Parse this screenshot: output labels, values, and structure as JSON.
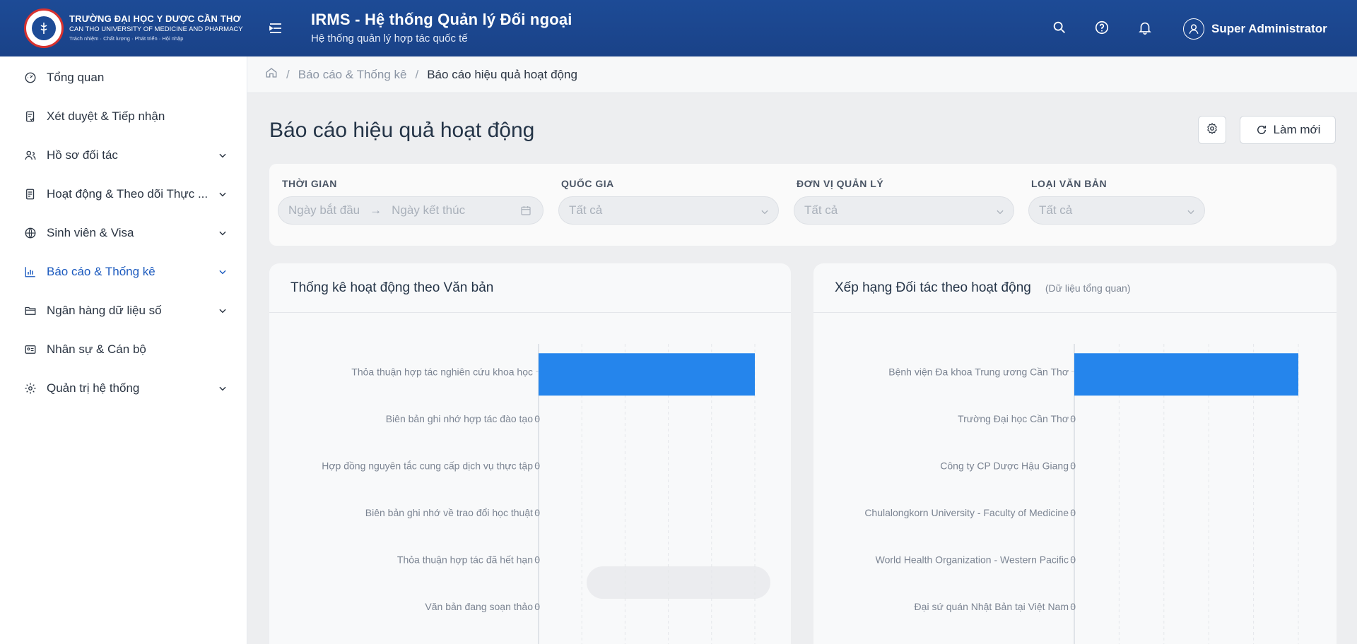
{
  "header": {
    "logo_line1": "TRƯỜNG ĐẠI HỌC Y DƯỢC CẦN THƠ",
    "logo_line2": "CAN THO UNIVERSITY OF MEDICINE AND PHARMACY",
    "logo_line3": "Trách nhiệm · Chất lượng · Phát triển · Hội nhập",
    "title": "IRMS - Hệ thống Quản lý Đối ngoại",
    "subtitle": "Hệ thống quản lý hợp tác quốc tế",
    "user_name": "Super Administrator"
  },
  "sidebar": {
    "items": [
      {
        "label": "Tổng quan",
        "icon": "dashboard-icon"
      },
      {
        "label": "Xét duyệt & Tiếp nhận",
        "icon": "approval-icon"
      },
      {
        "label": "Hồ sơ đối tác",
        "icon": "partners-icon"
      },
      {
        "label": "Hoạt động & Theo dõi Thực ...",
        "icon": "activity-icon"
      },
      {
        "label": "Sinh viên & Visa",
        "icon": "globe-icon"
      },
      {
        "label": "Báo cáo & Thống kê",
        "icon": "bar-chart-icon"
      },
      {
        "label": "Ngân hàng dữ liệu số",
        "icon": "folder-icon"
      },
      {
        "label": "Nhân sự & Cán bộ",
        "icon": "id-card-icon"
      },
      {
        "label": "Quản trị hệ thống",
        "icon": "gear-icon"
      }
    ]
  },
  "breadcrumb": {
    "parent": "Báo cáo & Thống kê",
    "current": "Báo cáo hiệu quả hoạt động"
  },
  "page": {
    "title": "Báo cáo hiệu quả hoạt động",
    "refresh_label": "Làm mới"
  },
  "filters": {
    "time_label": "THỜI GIAN",
    "start_placeholder": "Ngày bắt đầu",
    "end_placeholder": "Ngày kết thúc",
    "country_label": "QUỐC GIA",
    "country_value": "Tất cả",
    "unit_label": "ĐƠN VỊ QUẢN LÝ",
    "unit_value": "Tất cả",
    "doctype_label": "LOẠI VĂN BẢN",
    "doctype_value": "Tất cả"
  },
  "cards": {
    "left_title": "Thống kê hoạt động theo Văn bản",
    "right_title": "Xếp hạng Đối tác theo hoạt động",
    "right_subtitle": "(Dữ liệu tổng quan)"
  },
  "chart_data": [
    {
      "type": "bar",
      "orientation": "horizontal",
      "categories": [
        "Thỏa thuận hợp tác nghiên cứu khoa học",
        "Biên bản ghi nhớ hợp tác đào tạo",
        "Hợp đồng nguyên tắc cung cấp dịch vụ thực tập",
        "Biên bản ghi nhớ về trao đổi học thuật",
        "Thỏa thuận hợp tác đã hết hạn",
        "Văn bản đang soạn thảo"
      ],
      "values": [
        1,
        0,
        0,
        0,
        0,
        0
      ],
      "value_labels": [
        "",
        "0",
        "0",
        "0",
        "0",
        "0"
      ],
      "xlim": [
        0,
        1
      ],
      "color": "#2585ec",
      "grid": true
    },
    {
      "type": "bar",
      "orientation": "horizontal",
      "categories": [
        "Bệnh viện Đa khoa Trung ương Cần Thơ",
        "Trường Đại học Cần Thơ",
        "Công ty CP Dược Hậu Giang",
        "Chulalongkorn University - Faculty of Medicine",
        "World Health Organization - Western Pacific",
        "Đại sứ quán Nhật Bản tại Việt Nam"
      ],
      "values": [
        2,
        0,
        0,
        0,
        0,
        0
      ],
      "value_labels": [
        "",
        "0",
        "0",
        "0",
        "0",
        "0"
      ],
      "xlim": [
        0,
        2
      ],
      "color": "#2585ec",
      "grid": true
    }
  ]
}
